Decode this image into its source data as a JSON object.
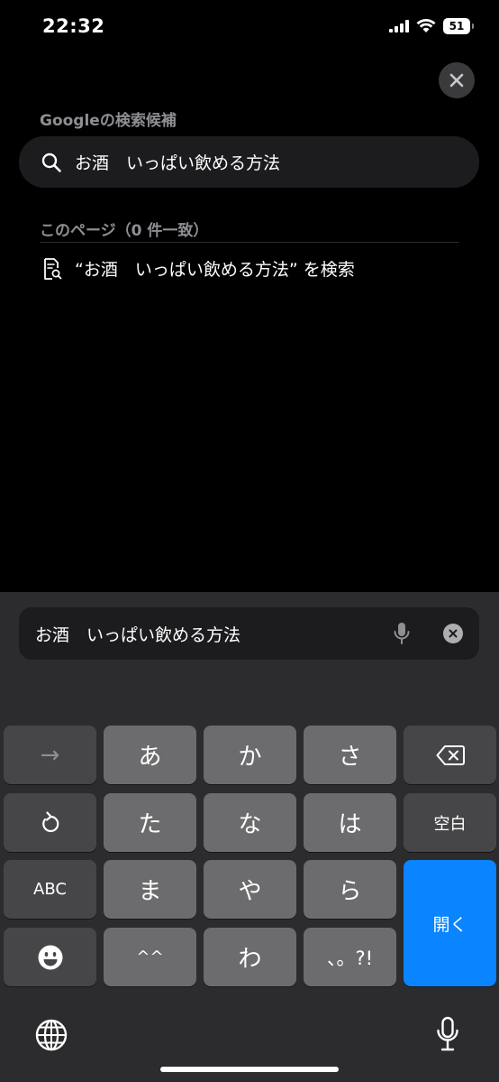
{
  "status": {
    "time": "22:32",
    "battery": "51"
  },
  "suggestions": {
    "google_label": "Googleの検索候補",
    "query_suggestion": "お酒　いっぱい飲める方法",
    "page_label": "このページ（0 件一致）",
    "find_in_page": "“お酒　いっぱい飲める方法” を検索"
  },
  "search_field": {
    "value": "お酒　いっぱい飲める方法"
  },
  "keyboard": {
    "row1": [
      "→",
      "あ",
      "か",
      "さ"
    ],
    "row2": [
      "た",
      "な",
      "は"
    ],
    "space_label": "空白",
    "row3": [
      "ABC",
      "ま",
      "や",
      "ら"
    ],
    "open_label": "開く",
    "row4": [
      "^^",
      "わ",
      "、。?!"
    ]
  },
  "colors": {
    "accent": "#0a84ff",
    "key": "#6c6c6e",
    "key_dark": "#464648",
    "keyboard_bg": "#2c2c2e"
  },
  "icons": {
    "close": "close-icon",
    "search": "search-icon",
    "find_in_page": "document-search-icon",
    "mic": "mic-icon",
    "clear": "clear-icon",
    "backspace": "backspace-icon",
    "undo": "undo-icon",
    "emoji": "emoji-icon",
    "globe": "globe-icon"
  }
}
